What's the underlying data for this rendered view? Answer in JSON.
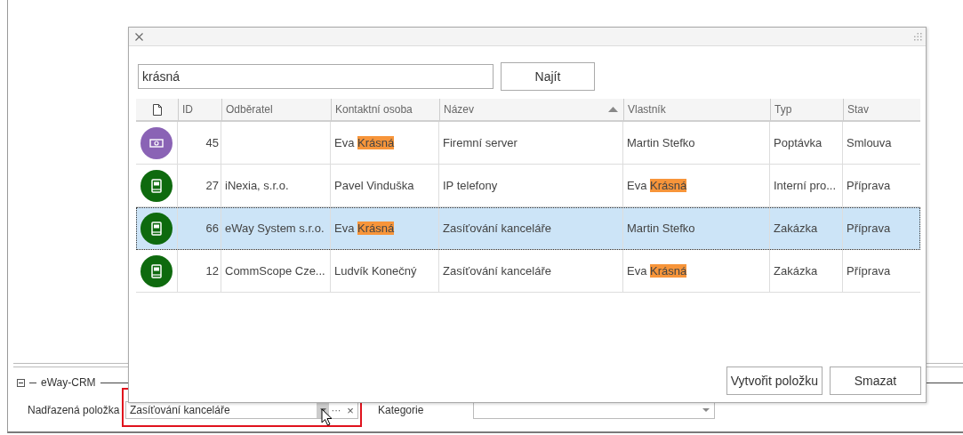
{
  "dialog": {
    "search": {
      "value": "krásná"
    },
    "find_button": "Najít",
    "table": {
      "columns": [
        {
          "label": "ID",
          "sorted": false
        },
        {
          "label": "Odběratel",
          "sorted": false
        },
        {
          "label": "Kontaktní osoba",
          "sorted": false
        },
        {
          "label": "Název",
          "sorted": true
        },
        {
          "label": "Vlastník",
          "sorted": false
        },
        {
          "label": "Typ",
          "sorted": false
        },
        {
          "label": "Stav",
          "sorted": false
        }
      ],
      "rows": [
        {
          "kind": "money",
          "selected": false,
          "cells": [
            "45",
            "",
            [
              {
                "text": "Eva ",
                "highlighted": false
              },
              {
                "text": "Krásná",
                "highlighted": true
              }
            ],
            "Firemní server",
            "Martin Stefko",
            "Poptávka",
            "Smlouva"
          ]
        },
        {
          "kind": "book",
          "selected": false,
          "cells": [
            "27",
            "iNexia, s.r.o.",
            "Pavel Vinduška",
            "IP telefony",
            [
              {
                "text": "Eva ",
                "highlighted": false
              },
              {
                "text": "Krásná",
                "highlighted": true
              }
            ],
            "Interní pro...",
            "Příprava"
          ]
        },
        {
          "kind": "book",
          "selected": true,
          "cells": [
            "66",
            "eWay System s.r.o.",
            [
              {
                "text": "Eva ",
                "highlighted": false
              },
              {
                "text": "Krásná",
                "highlighted": true
              }
            ],
            "Zasíťování kanceláře",
            "Martin Stefko",
            "Zakázka",
            "Příprava"
          ]
        },
        {
          "kind": "book",
          "selected": false,
          "cells": [
            "12",
            "CommScope Cze...",
            "Ludvík Konečný",
            "Zasíťování kanceláře",
            [
              {
                "text": "Eva ",
                "highlighted": false
              },
              {
                "text": "Krásná",
                "highlighted": true
              }
            ],
            "Zakázka",
            "Příprava"
          ]
        }
      ]
    },
    "buttons": [
      "Vytvořit položku",
      "Smazat"
    ]
  },
  "section": {
    "title": "eWay-CRM",
    "expanded": true,
    "fields": [
      {
        "kind": "lookup",
        "label": "Nadřazená položka",
        "value": "Zasíťování kanceláře",
        "ellipsis": "···",
        "clear": "×"
      },
      {
        "kind": "dropdown",
        "label": "Kategorie"
      }
    ]
  }
}
